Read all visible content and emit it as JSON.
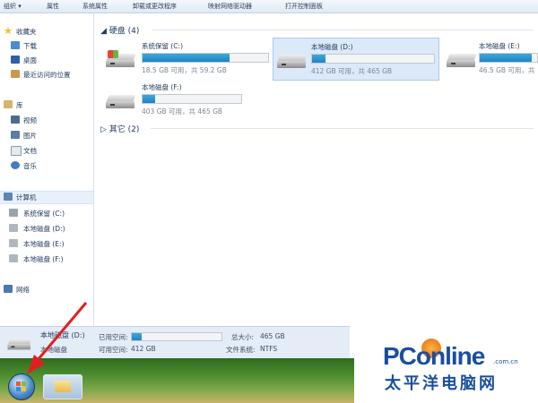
{
  "toolbar": {
    "organize": "组织 ▾",
    "properties": "属性",
    "system_properties": "系统属性",
    "uninstall": "卸载或更改程序",
    "map_drive": "映射网络驱动器",
    "control_panel": "打开控制面板"
  },
  "nav": {
    "favorites": "收藏夹",
    "downloads": "下载",
    "desktop": "桌面",
    "recent": "最近访问的位置",
    "libraries": "库",
    "videos": "视频",
    "pictures": "图片",
    "documents": "文档",
    "music": "音乐",
    "computer": "计算机",
    "drive_c": "系统保留 (C:)",
    "drive_d": "本地磁盘 (D:)",
    "drive_e": "本地磁盘 (E:)",
    "drive_f": "本地磁盘 (F:)",
    "network": "网络"
  },
  "content": {
    "hdd_header": "硬盘 (4)",
    "other_header": "其它 (2)",
    "drives": [
      {
        "name": "系统保留 (C:)",
        "free": "18.5 GB 可用，共 59.2 GB",
        "used_fraction": 0.69
      },
      {
        "name": "本地磁盘 (D:)",
        "free": "412 GB 可用，共 465 GB",
        "used_fraction": 0.11
      },
      {
        "name": "本地磁盘 (E:)",
        "free": "46.5 GB 可用，共",
        "used_fraction": 0.9
      },
      {
        "name": "本地磁盘 (F:)",
        "free": "403 GB 可用，共 465 GB",
        "used_fraction": 0.13
      }
    ]
  },
  "details": {
    "name": "本地磁盘 (D:)",
    "type": "本地磁盘",
    "used_label": "已用空间:",
    "free_label": "可用空间:",
    "free_value": "412 GB",
    "total_label": "总大小:",
    "total_value": "465 GB",
    "fs_label": "文件系统:",
    "fs_value": "NTFS",
    "used_fraction": 0.11
  },
  "watermark": {
    "brand": "PConline",
    "domain": ".com.cn",
    "chinese": "太平洋电脑网"
  },
  "colors": {
    "bar_fill": "#1d84c4",
    "selection": "#dce9f8",
    "arrow": "#e02020"
  }
}
